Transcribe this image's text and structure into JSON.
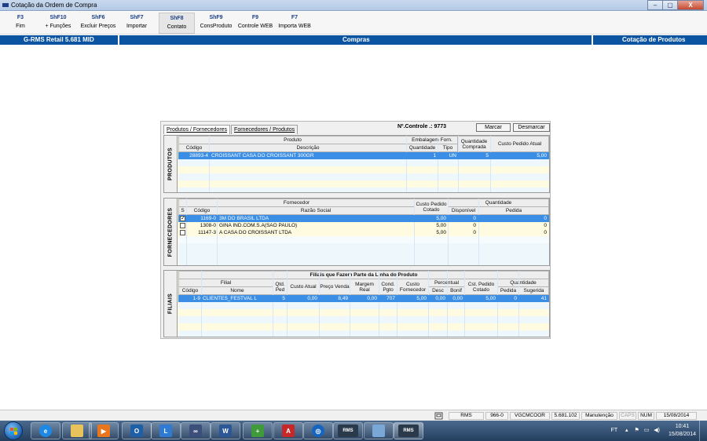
{
  "window": {
    "title": "Cotação da Ordem de Compra",
    "controls": [
      "–",
      "▢",
      "X"
    ]
  },
  "fkeys": [
    {
      "key": "F3",
      "label": "Fim"
    },
    {
      "key": "ShF10",
      "label": "+ Funções"
    },
    {
      "key": "ShF6",
      "label": "Excluir Preços"
    },
    {
      "key": "ShF7",
      "label": "Importar"
    },
    {
      "key": "ShF8",
      "label": "Contato"
    },
    {
      "key": "ShF9",
      "label": "ConsProduto"
    },
    {
      "key": "F9",
      "label": "Controle WEB"
    },
    {
      "key": "F7",
      "label": "Importa WEB"
    }
  ],
  "header": {
    "system": "G-RMS Retail 5.681 MID",
    "module": "Compras",
    "screen": "Cotação de Produtos"
  },
  "tabs": [
    "Produtos / Fornecedores",
    "Fornecedores / Produtos"
  ],
  "controle": "Nº.Controle .: 9773",
  "buttons": {
    "marcar": "Marcar",
    "desmarcar": "Desmarcar"
  },
  "produtos": {
    "label": "PRODUTOS",
    "headers": {
      "produto": "Produto",
      "embalagem": "Embalagem Forn.",
      "quantidade_comprada": "Quantidade Comprada",
      "custo_pedido_atual": "Custo Pedido Atual",
      "codigo": "Código",
      "descricao": "Descrição",
      "quantidade": "Quantidade",
      "tipo": "Tipo"
    },
    "rows": [
      {
        "codigo": "28893-4",
        "descricao": "CROISSANT CASA DO CROISSANT 300GR",
        "quantidade": "1",
        "tipo": "UN",
        "qtd_comprada": "5",
        "custo": "5,00"
      }
    ]
  },
  "fornecedores": {
    "label": "FORNECEDORES",
    "headers": {
      "fornecedor": "Fornecedor",
      "custo_pedido_cotado": "Custo Pedido Cotado",
      "quantidade": "Quantidade",
      "s": "S",
      "codigo": "Código",
      "razao_social": "Razão Social",
      "disponivel": "Disponível",
      "pedida": "Pedida"
    },
    "rows": [
      {
        "check": "✓",
        "codigo": "1169-0",
        "razao": "3M DO BRASIL LTDA",
        "custo": "5,00",
        "disponivel": "0",
        "pedida": "0"
      },
      {
        "check": "",
        "codigo": "1308-0",
        "razao": "GINA IND.COM.S.A(SAO PAULO)",
        "custo": "5,00",
        "disponivel": "0",
        "pedida": "0"
      },
      {
        "check": "",
        "codigo": "11147-3",
        "razao": "A CASA DO CROISSANT LTDA",
        "custo": "5,00",
        "disponivel": "0",
        "pedida": "0"
      }
    ]
  },
  "filiais": {
    "label": "FILIAIS",
    "title": "Filiais que Fazem Parte da Linha do Produto",
    "headers": {
      "filial": "Filial",
      "qtd_ped": "Qtd. Ped",
      "custo_atual": "Custo Atual",
      "preco_venda": "Preço Venda",
      "margem_real": "Margem Real",
      "cond_pgto": "Cond. Pgto",
      "custo_fornecedor": "Custo Fornecedor",
      "percentual": "Percentual",
      "cst_pedido_cotado": "Cst. Pedido Cotado",
      "quantidade": "Quantidade",
      "codigo": "Código",
      "nome": "Nome",
      "desc": "Desc",
      "bonif": "Bonif",
      "pedida": "Pedida",
      "sugerida": "Sugerida"
    },
    "rows": [
      {
        "codigo": "1-9",
        "nome": "CLIENTES_FESTVAL L",
        "qtd_ped": "5",
        "custo_atual": "0,00",
        "preco_venda": "8,49",
        "margem_real": "0,00",
        "cond_pgto": "707",
        "custo_fornecedor": "5,00",
        "desc": "0,00",
        "bonif": "0,00",
        "cst_cotado": "5,00",
        "pedida": "0",
        "sugerida": "41"
      }
    ]
  },
  "statusbar": {
    "rms": "RMS",
    "code": "966-0",
    "user": "VGCMCOOR",
    "version": "5.681.102",
    "mode": "Manutenção",
    "caps": "CAPS",
    "num": "NUM",
    "date": "15/08/2014"
  },
  "taskbar": {
    "tray_lang": "FT",
    "time": "10:41",
    "date": "15/08/2014",
    "rms_label": "RMS"
  }
}
